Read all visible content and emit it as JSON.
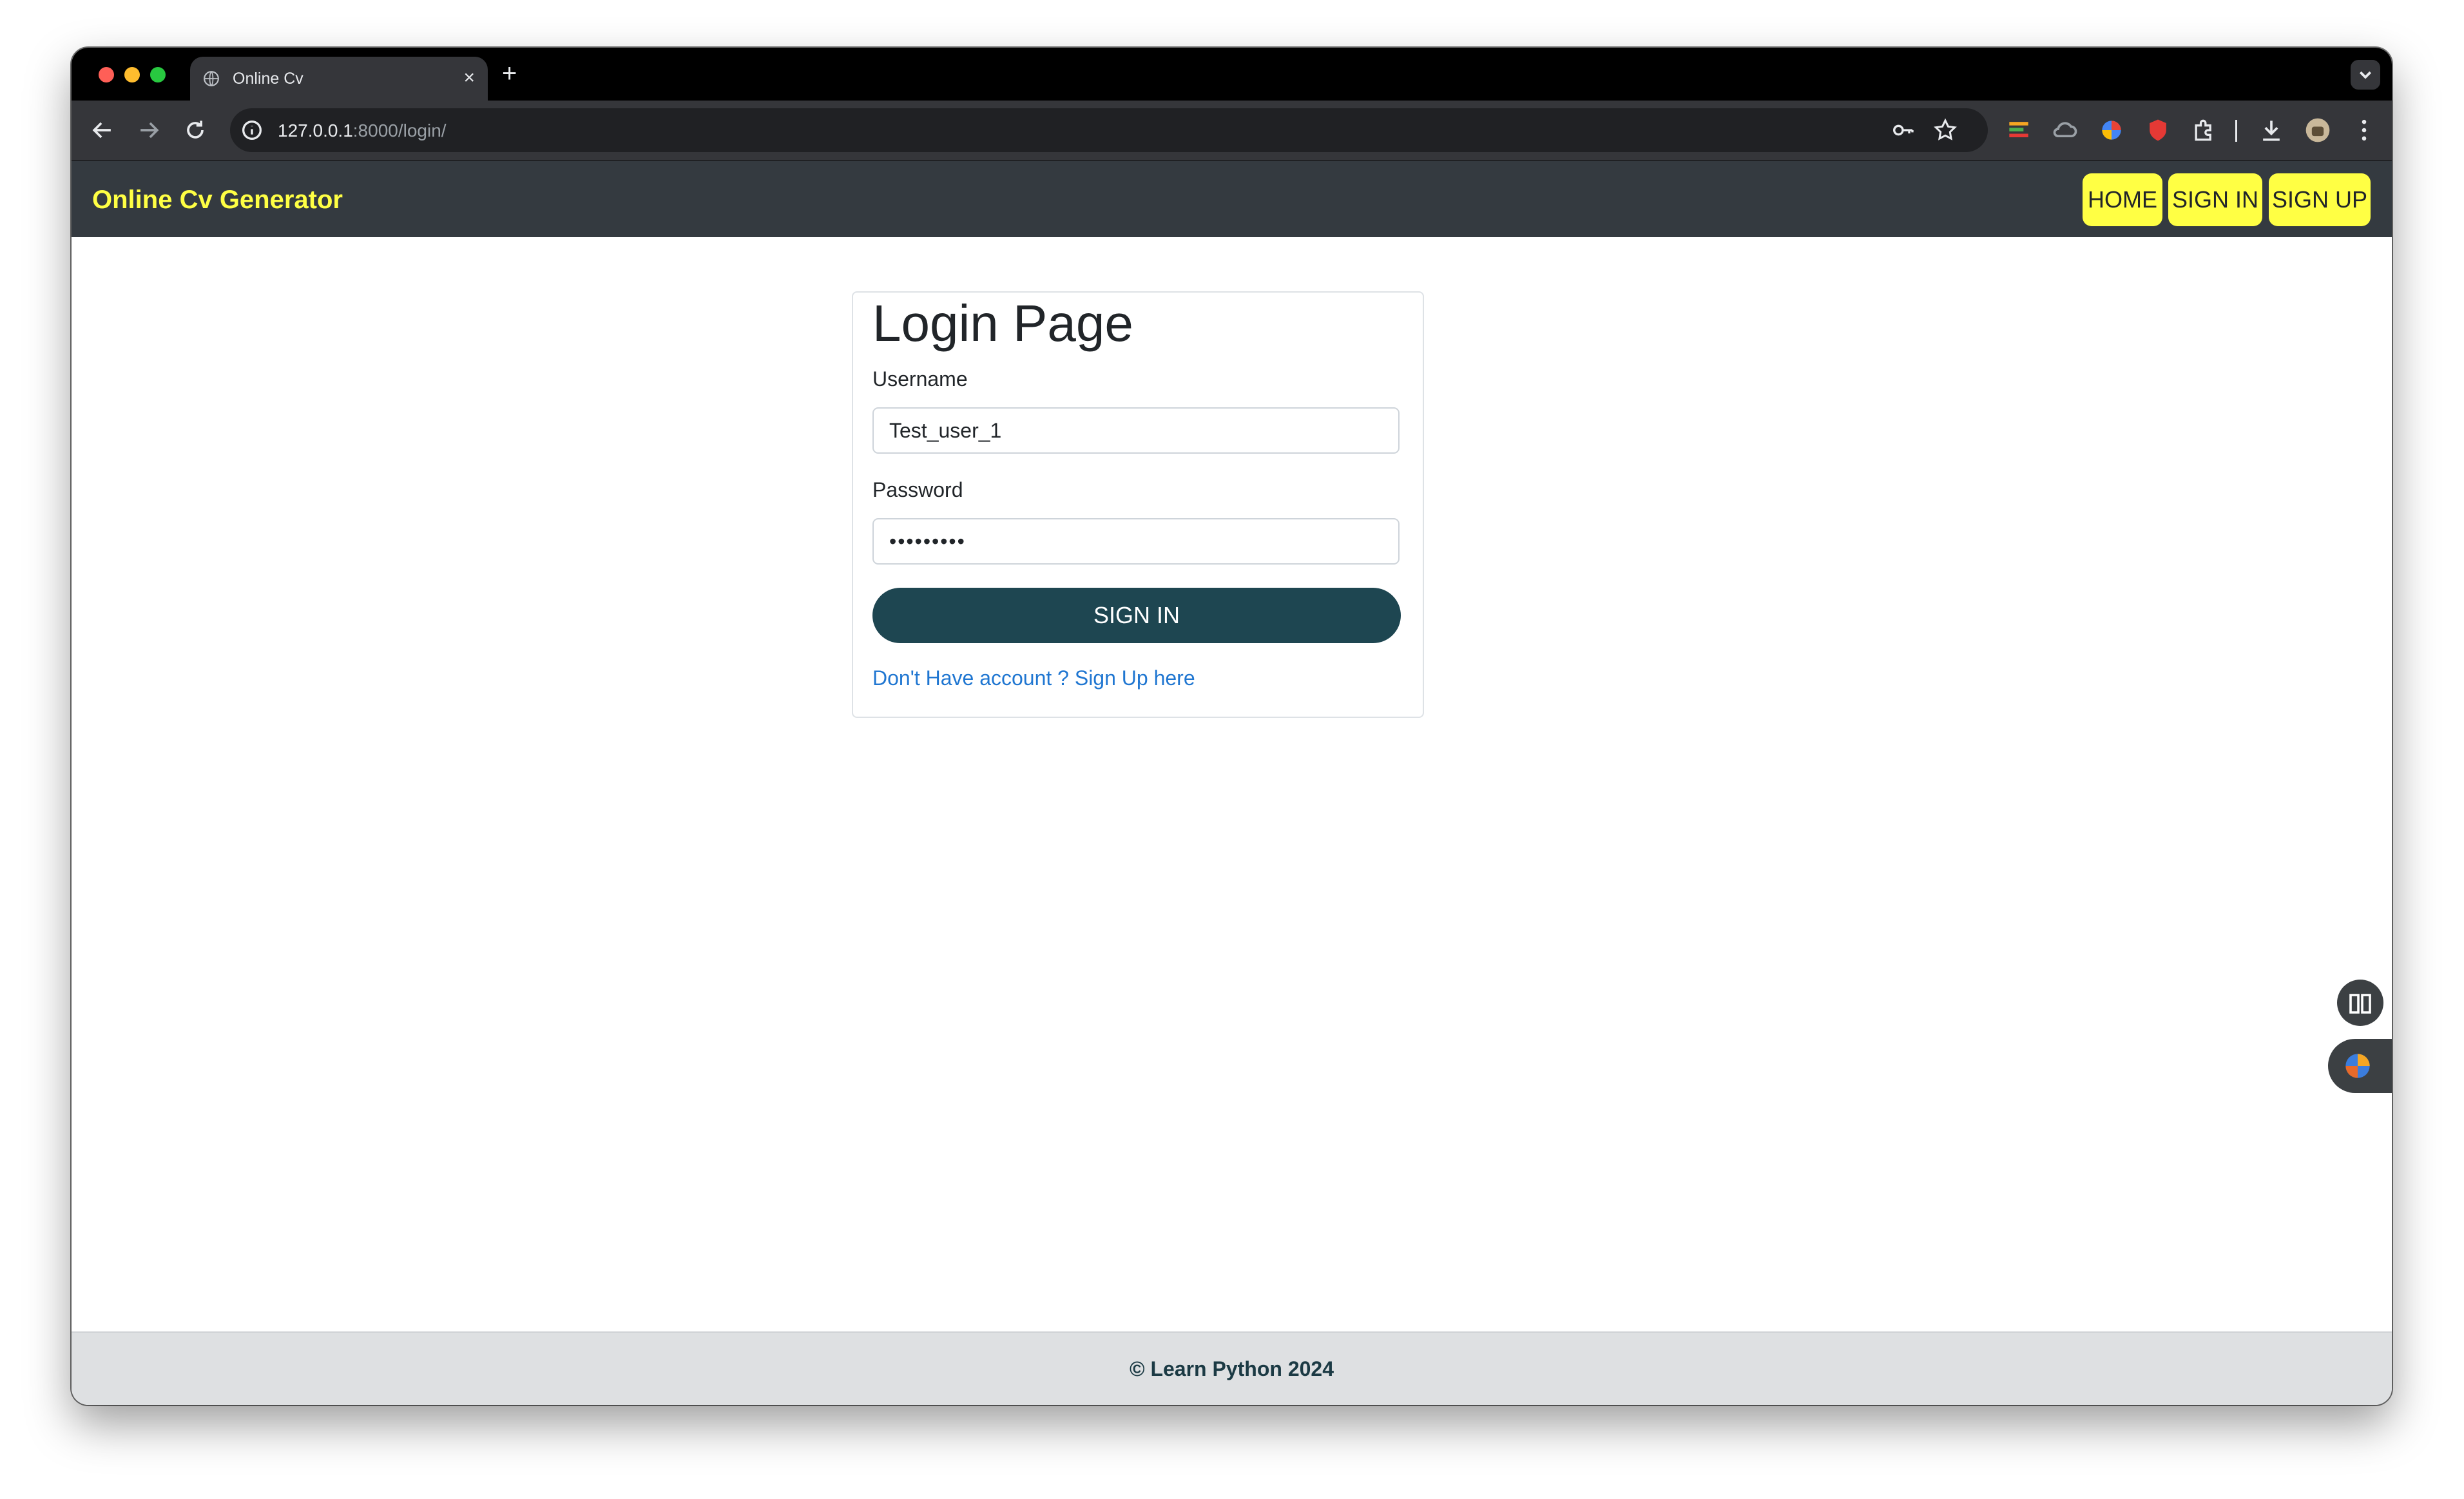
{
  "browser": {
    "tab_title": "Online Cv",
    "tab_close": "×",
    "new_tab": "+",
    "url_host": "127.0.0.1",
    "url_path": ":8000/login/"
  },
  "navbar": {
    "brand": "Online Cv Generator",
    "home": "HOME",
    "sign_in": "SIGN IN",
    "sign_up": "SIGN UP",
    "accent_color": "#ffff44"
  },
  "login": {
    "title": "Login Page",
    "username_label": "Username",
    "username_value": "Test_user_1",
    "password_label": "Password",
    "password_value": "•••••••••",
    "submit_label": "SIGN IN",
    "signup_link": "Don't Have account ? Sign Up here",
    "button_color": "#1e4651"
  },
  "footer": {
    "text": "© Learn Python 2024"
  }
}
